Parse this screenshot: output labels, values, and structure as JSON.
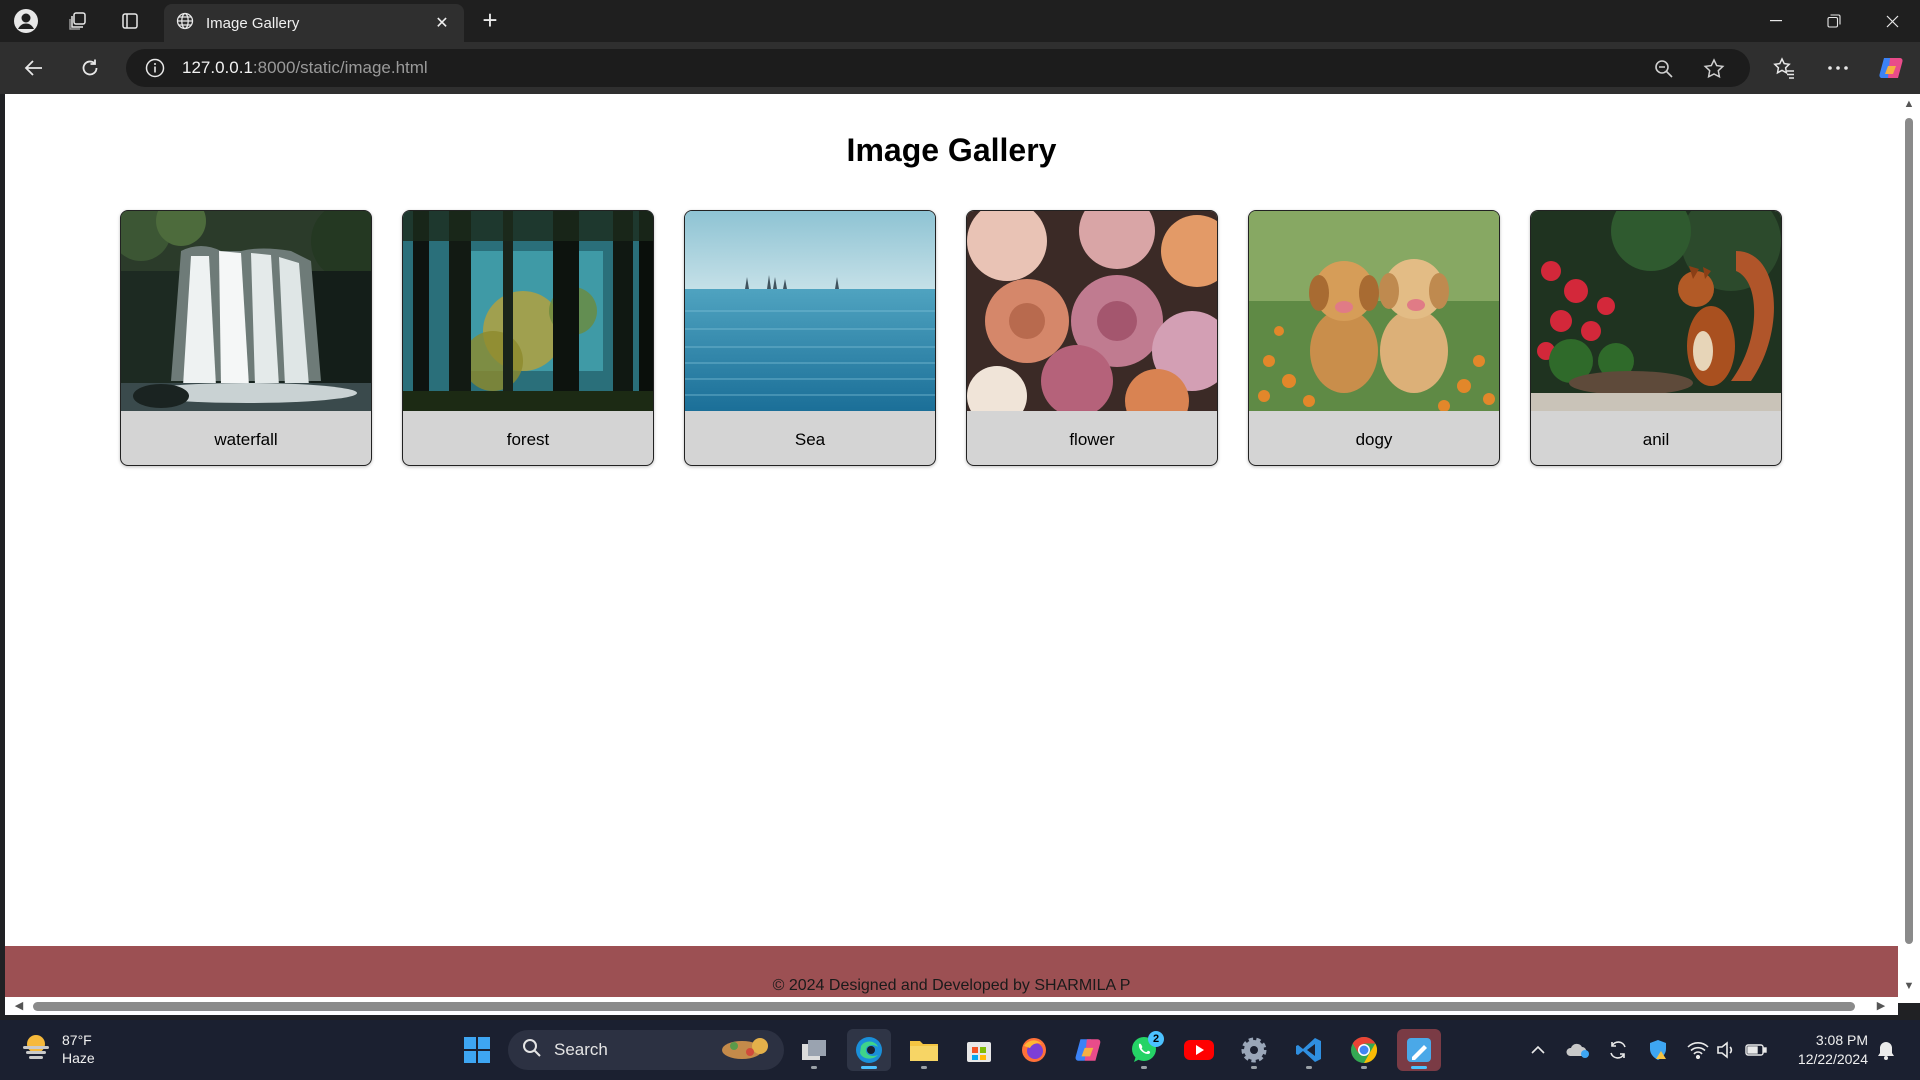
{
  "browser": {
    "tab_title": "Image Gallery",
    "url_host": "127.0.0.1",
    "url_path": ":8000/static/image.html"
  },
  "page": {
    "title": "Image Gallery",
    "images": [
      {
        "caption": "waterfall",
        "icon": "waterfall-photo"
      },
      {
        "caption": "forest",
        "icon": "forest-photo"
      },
      {
        "caption": "Sea",
        "icon": "sea-photo"
      },
      {
        "caption": "flower",
        "icon": "flower-photo"
      },
      {
        "caption": "dogy",
        "icon": "puppies-photo"
      },
      {
        "caption": "anil",
        "icon": "squirrel-photo"
      }
    ],
    "footer": "© 2024 Designed and Developed by SHARMILA P",
    "footer_color": "#9c5053"
  },
  "taskbar": {
    "weather_temp": "87°F",
    "weather_desc": "Haze",
    "search_placeholder": "Search",
    "whatsapp_badge": "2",
    "time": "3:08 PM",
    "date": "12/22/2024"
  }
}
